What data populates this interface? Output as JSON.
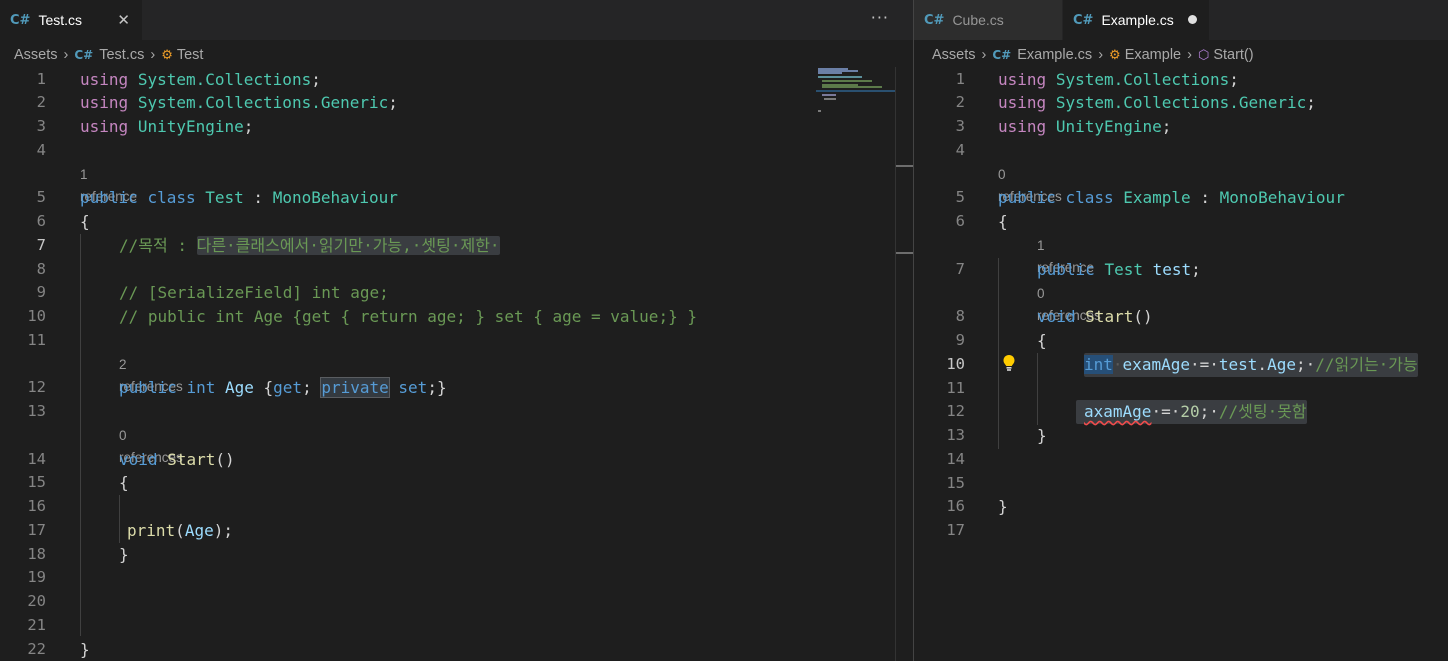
{
  "left": {
    "tab": {
      "label": "Test.cs",
      "icon": "C#",
      "close": "✕"
    },
    "more_actions": "···",
    "breadcrumb": {
      "root": "Assets",
      "file": "Test.cs",
      "symbol": "Test"
    },
    "lines": [
      {
        "n": "1"
      },
      {
        "n": "2"
      },
      {
        "n": "3"
      },
      {
        "n": "4"
      },
      {
        "n": "5"
      },
      {
        "n": "6"
      },
      {
        "n": "7"
      },
      {
        "n": "8"
      },
      {
        "n": "9"
      },
      {
        "n": "10"
      },
      {
        "n": "11"
      },
      {
        "n": "12"
      },
      {
        "n": "13"
      },
      {
        "n": "14"
      },
      {
        "n": "15"
      },
      {
        "n": "16"
      },
      {
        "n": "17"
      },
      {
        "n": "18"
      },
      {
        "n": "19"
      },
      {
        "n": "20"
      },
      {
        "n": "21"
      },
      {
        "n": "22"
      }
    ],
    "code": {
      "l1_kw": "using",
      "l1_ns": "System.Collections",
      "l1_end": ";",
      "l2_kw": "using",
      "l2_ns": "System.Collections.Generic",
      "l2_end": ";",
      "l3_kw": "using",
      "l3_ns": "UnityEngine",
      "l3_end": ";",
      "lens5": "1 reference",
      "l5_public": "public",
      "l5_class": "class",
      "l5_name": "Test",
      "l5_colon": " : ",
      "l5_base": "MonoBehaviour",
      "l6": "{",
      "l7_prefix": "//목적 : ",
      "l7_hl": "다른·클래스에서·읽기만·가능,·셋팅·제한·",
      "l9": "// [SerializeField] int age;",
      "l10": "// public int Age {get { return age; } set { age = value;} }",
      "lens12": "2 references",
      "l12_public": "public",
      "l12_int": "int",
      "l12_name": "Age",
      "l12_open": " {",
      "l12_get": "get",
      "l12_semi": "; ",
      "l12_private": "private",
      "l12_set": "set",
      "l12_end": ";}",
      "lens14": "0 references",
      "l14_void": "void",
      "l14_name": "Start",
      "l14_paren": "()",
      "l15": "{",
      "l17_fn": "print",
      "l17_open": "(",
      "l17_arg": "Age",
      "l17_close": ");",
      "l18": "}",
      "l22": "}"
    }
  },
  "right": {
    "tabs": [
      {
        "label": "Cube.cs",
        "icon": "C#"
      },
      {
        "label": "Example.cs",
        "icon": "C#"
      }
    ],
    "breadcrumb": {
      "root": "Assets",
      "file": "Example.cs",
      "class": "Example",
      "method": "Start()"
    },
    "lines": [
      {
        "n": "1"
      },
      {
        "n": "2"
      },
      {
        "n": "3"
      },
      {
        "n": "4"
      },
      {
        "n": "5"
      },
      {
        "n": "6"
      },
      {
        "n": "7"
      },
      {
        "n": "8"
      },
      {
        "n": "9"
      },
      {
        "n": "10"
      },
      {
        "n": "11"
      },
      {
        "n": "12"
      },
      {
        "n": "13"
      },
      {
        "n": "14"
      },
      {
        "n": "15"
      },
      {
        "n": "16"
      },
      {
        "n": "17"
      }
    ],
    "code": {
      "l1_kw": "using",
      "l1_ns": "System.Collections",
      "l1_end": ";",
      "l2_kw": "using",
      "l2_ns": "System.Collections.Generic",
      "l2_end": ";",
      "l3_kw": "using",
      "l3_ns": "UnityEngine",
      "l3_end": ";",
      "lens5": "0 references",
      "l5_public": "public",
      "l5_class": "class",
      "l5_name": "Example",
      "l5_colon": " : ",
      "l5_base": "MonoBehaviour",
      "l6": "{",
      "lens7": "1 reference",
      "l7_public": "public",
      "l7_type": "Test",
      "l7_var": "test",
      "l7_end": ";",
      "lens8": "0 references",
      "l8_void": "void",
      "l8_name": "Start",
      "l8_paren": "()",
      "l9": "{",
      "l10_int": "int",
      "l10_dot1": "·",
      "l10_var": "examAge",
      "l10_eq": "·=·",
      "l10_obj": "test",
      "l10_dot": ".",
      "l10_prop": "Age",
      "l10_semi": ";·",
      "l10_cm": "//읽기는·가능",
      "l12_var": "axamAge",
      "l12_eq": "·=·",
      "l12_num": "20",
      "l12_semi": ";·",
      "l12_cm": "//셋팅·못함",
      "l13": "}",
      "l16": "}"
    }
  }
}
